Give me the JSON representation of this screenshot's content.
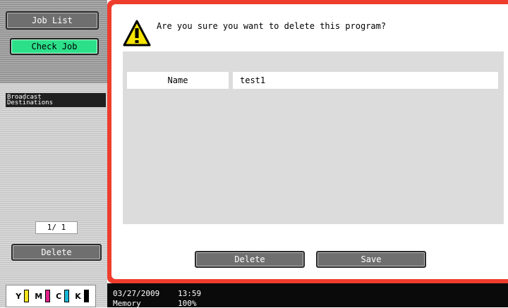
{
  "sidebar": {
    "job_list_label": "Job List",
    "check_job_label": "Check Job",
    "broadcast_label_line1": "Broadcast",
    "broadcast_label_line2": "Destinations",
    "page_indicator": "1/ 1",
    "delete_label": "Delete",
    "toner": [
      {
        "label": "Y",
        "color": "#f2e21b"
      },
      {
        "label": "M",
        "color": "#e0218a"
      },
      {
        "label": "C",
        "color": "#1cb7d6"
      },
      {
        "label": "K",
        "color": "#000000"
      }
    ]
  },
  "dialog": {
    "message": "Are you sure you want to delete this program?",
    "name_label": "Name",
    "name_value": "test1",
    "delete_button": "Delete",
    "save_button": "Save"
  },
  "statusbar": {
    "date": "03/27/2009",
    "time": "13:59",
    "memory_label": "Memory",
    "memory_value": "100%"
  },
  "colors": {
    "frame_accent": "#ef3d2d",
    "check_job_green": "#2ce08a",
    "warning_yellow": "#f5e400"
  }
}
